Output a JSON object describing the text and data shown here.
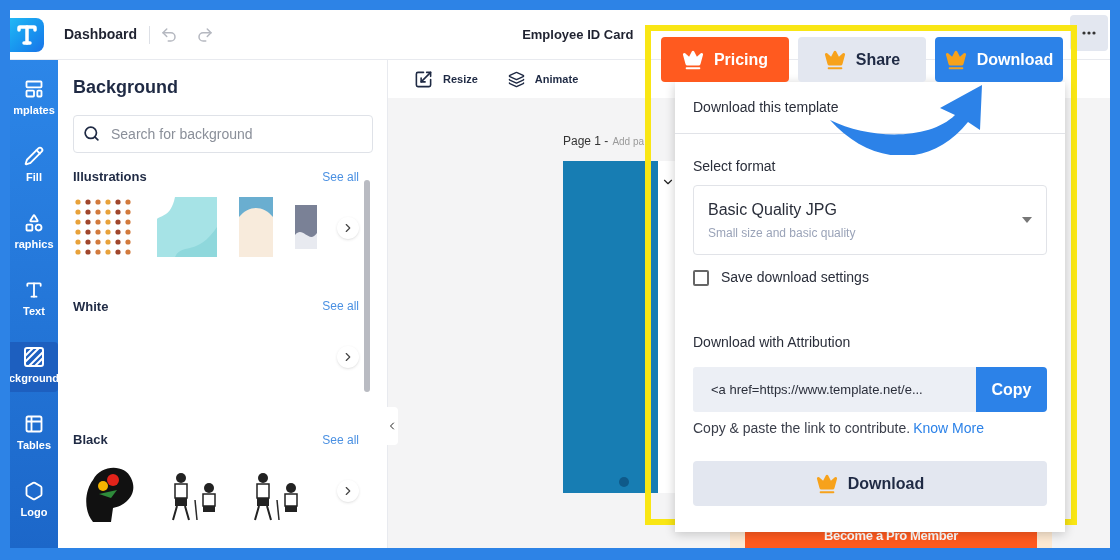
{
  "top_bar": {
    "title": "Dashboard",
    "document_title": "Employee ID Card"
  },
  "rail": [
    {
      "label": "mplates",
      "kind": "templates",
      "selected": false
    },
    {
      "label": "Fill",
      "kind": "fill",
      "selected": false
    },
    {
      "label": "raphics",
      "kind": "graphics",
      "selected": false
    },
    {
      "label": "Text",
      "kind": "text",
      "selected": false
    },
    {
      "label": "ckground",
      "kind": "background",
      "selected": true
    },
    {
      "label": "Tables",
      "kind": "tables",
      "selected": false
    },
    {
      "label": "Logo",
      "kind": "logo",
      "selected": false
    }
  ],
  "panel": {
    "title": "Background",
    "search": {
      "placeholder": "Search for background"
    },
    "sections": [
      {
        "title": "Illustrations",
        "see_all": "See all",
        "kind": "illustrations"
      },
      {
        "title": "White",
        "see_all": "See all",
        "kind": "white"
      },
      {
        "title": "Black",
        "see_all": "See all",
        "kind": "black"
      }
    ]
  },
  "toolbar": [
    {
      "label": "Resize",
      "kind": "resize"
    },
    {
      "label": "Animate",
      "kind": "animate"
    }
  ],
  "canvas": {
    "page_label": "Page 1 -",
    "page_hint": "Add pa"
  },
  "promo": "Become a Pro Member",
  "popup": {
    "buttons": [
      {
        "label": "Pricing",
        "kind": "pricing"
      },
      {
        "label": "Share",
        "kind": "share"
      },
      {
        "label": "Download",
        "kind": "download"
      }
    ],
    "header": "Download this template",
    "format_label": "Select format",
    "format": {
      "value": "Basic Quality JPG",
      "hint": "Small size and basic quality"
    },
    "save_settings": {
      "label": "Save download settings",
      "checked": false
    },
    "attribution_label": "Download with Attribution",
    "attribution_code": "<a href=https://www.template.net/e...",
    "copy": "Copy",
    "note": "Copy & paste the link to contribute.",
    "link": "Know More",
    "download": "Download"
  }
}
